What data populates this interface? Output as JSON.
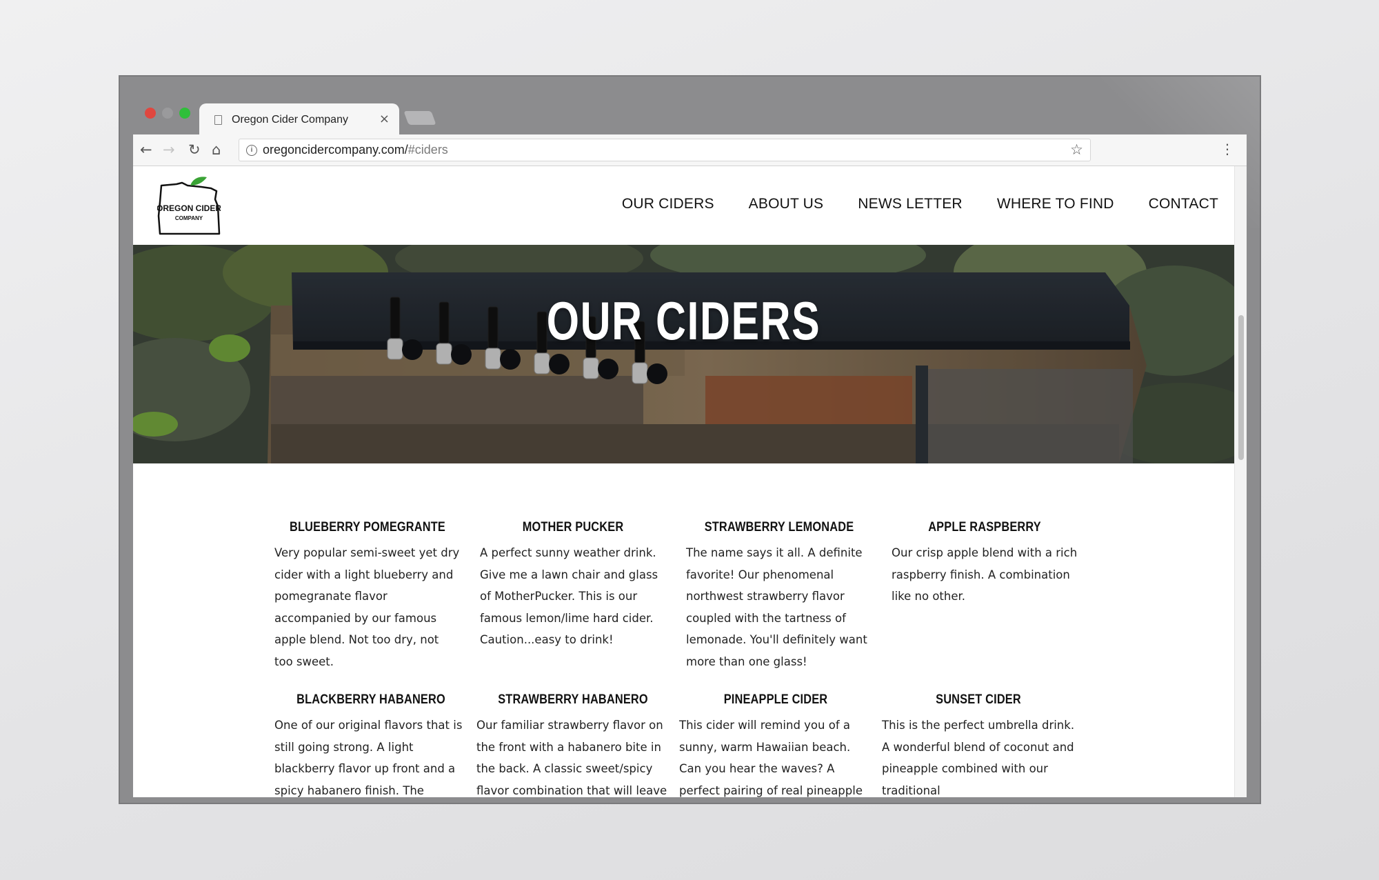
{
  "browser": {
    "tab_title": "Oregon Cider Company",
    "tab_close": "×",
    "url_host": "oregoncidercompany.com/",
    "url_path": "#ciders",
    "icons": {
      "back": "←",
      "forward": "→",
      "reload": "↻",
      "home": "⌂",
      "info": "i",
      "star": "☆",
      "menu": "⋮"
    }
  },
  "site": {
    "logo": {
      "line1": "OREGON CIDER",
      "line2": "COMPANY",
      "leaf_color": "#3aa335"
    },
    "nav": [
      {
        "label": "OUR CIDERS"
      },
      {
        "label": "ABOUT US"
      },
      {
        "label": "NEWS LETTER"
      },
      {
        "label": "WHERE TO FIND"
      },
      {
        "label": "CONTACT"
      }
    ],
    "hero_title": "OUR CIDERS"
  },
  "ciders": [
    {
      "name": "BLUEBERRY POMEGRANTE",
      "description": "Very popular semi-sweet yet dry cider with a light blueberry and pomegranate flavor accompanied by our famous apple blend. Not too dry, not too sweet."
    },
    {
      "name": "MOTHER PUCKER",
      "description": "A perfect sunny weather drink. Give me a lawn chair and glass of MotherPucker. This is our famous lemon/lime hard cider. Caution...easy to drink!"
    },
    {
      "name": "STRAWBERRY LEMONADE",
      "description": "The name says it all. A definite favorite! Our phenomenal northwest strawberry flavor coupled with the tartness of lemonade. You'll definitely want more than one glass!"
    },
    {
      "name": "APPLE RASPBERRY",
      "description": "Our crisp apple blend with a rich raspberry finish. A combination like no other."
    },
    {
      "name": "BLACKBERRY HABANERO",
      "description": "One of our original flavors that is still going strong. A light blackberry flavor up front and a spicy habanero finish. The"
    },
    {
      "name": "STRAWBERRY HABANERO",
      "description": "Our familiar strawberry flavor on the front with a habanero bite in the back. A classic sweet/spicy flavor combination that will leave"
    },
    {
      "name": "PINEAPPLE CIDER",
      "description": "This cider will remind you of a sunny, warm Hawaiian beach. Can you hear the waves? A perfect pairing of real pineapple"
    },
    {
      "name": "SUNSET CIDER",
      "description": "This is the perfect umbrella drink. A wonderful blend of coconut and pineapple combined with our traditional"
    }
  ]
}
